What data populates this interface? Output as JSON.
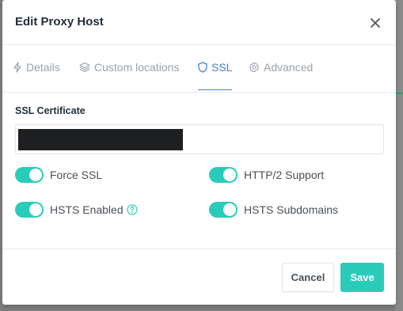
{
  "modal": {
    "title": "Edit Proxy Host"
  },
  "tabs": [
    {
      "label": "Details",
      "icon": "bolt-icon",
      "active": false
    },
    {
      "label": "Custom locations",
      "icon": "layers-icon",
      "active": false
    },
    {
      "label": "SSL",
      "icon": "shield-icon",
      "active": true
    },
    {
      "label": "Advanced",
      "icon": "gear-icon",
      "active": false
    }
  ],
  "ssl": {
    "certificate_label": "SSL Certificate",
    "toggles": {
      "force_ssl": {
        "label": "Force SSL",
        "on": true
      },
      "http2": {
        "label": "HTTP/2 Support",
        "on": true
      },
      "hsts_enabled": {
        "label": "HSTS Enabled",
        "on": true
      },
      "hsts_subdomains": {
        "label": "HSTS Subdomains",
        "on": true
      }
    }
  },
  "footer": {
    "cancel_label": "Cancel",
    "save_label": "Save"
  },
  "colors": {
    "accent": "#2bcbba",
    "tab_active": "#467fcf",
    "text_muted": "#9aa0ac"
  }
}
